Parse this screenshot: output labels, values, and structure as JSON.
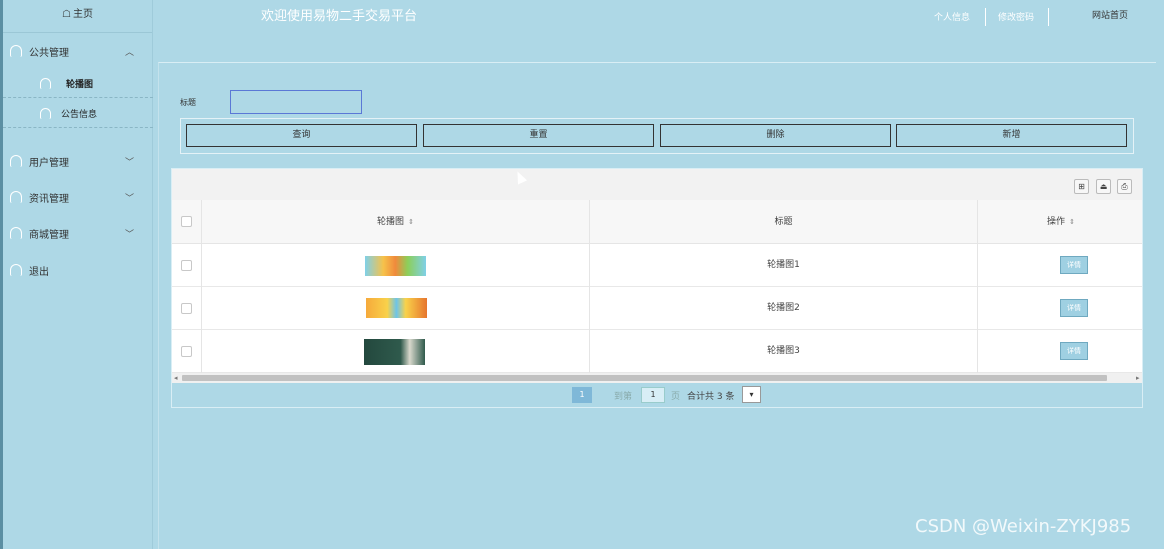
{
  "sidebar": {
    "home": "主页",
    "menus": [
      {
        "label": "公共管理",
        "arrow": "^"
      },
      {
        "label": "用户管理",
        "arrow": "v"
      },
      {
        "label": "资讯管理",
        "arrow": "v"
      },
      {
        "label": "商城管理",
        "arrow": "v"
      },
      {
        "label": "退出",
        "arrow": ""
      }
    ],
    "sub_items": [
      {
        "label": "轮播图"
      },
      {
        "label": "公告信息"
      }
    ]
  },
  "header": {
    "title": "欢迎使用易物二手交易平台",
    "nav": [
      "个人信息",
      "修改密码",
      "网站首页"
    ]
  },
  "search": {
    "label": "标题",
    "value": ""
  },
  "buttons": [
    "查询",
    "重置",
    "删除",
    "新增"
  ],
  "table": {
    "toolbar_icons": [
      "columns-icon",
      "export-icon",
      "print-icon"
    ],
    "headers": [
      "轮播图",
      "标题",
      "操作"
    ],
    "rows": [
      {
        "title": "轮播图1",
        "action": "详情"
      },
      {
        "title": "轮播图2",
        "action": "详情"
      },
      {
        "title": "轮播图3",
        "action": "详情"
      }
    ]
  },
  "pagination": {
    "current": "1",
    "goto_label": "到第",
    "goto_value": "1",
    "page_unit": "页",
    "total_text": "合计共 3 条"
  },
  "watermark": "CSDN @Weixin-ZYKJ985"
}
